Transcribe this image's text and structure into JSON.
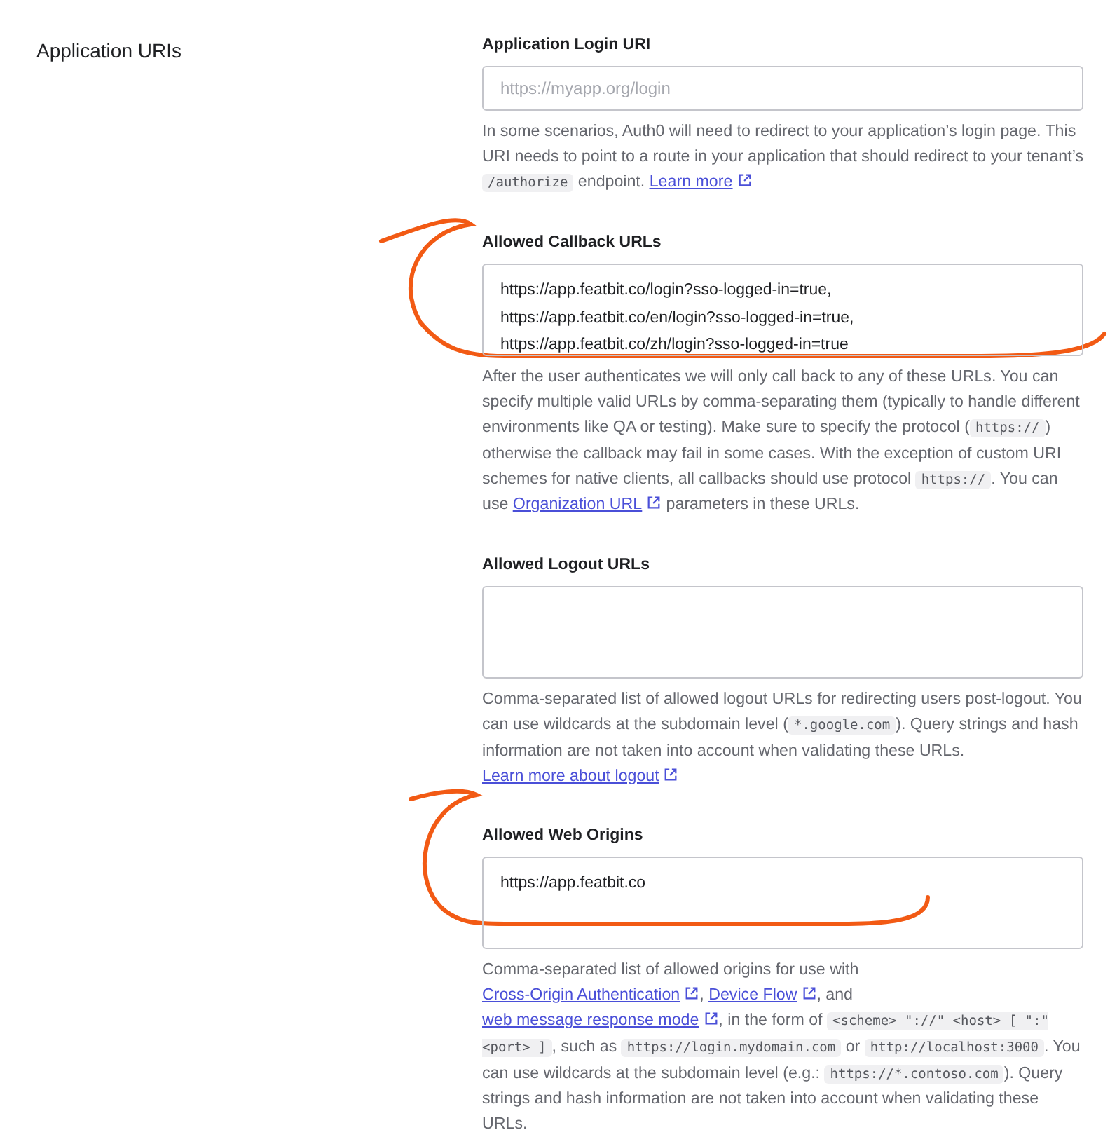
{
  "section": {
    "title": "Application URIs"
  },
  "fields": [
    {
      "label": "Application Login URI",
      "kind": "input",
      "placeholder": "https://myapp.org/login",
      "help": [
        {
          "kind": "text",
          "text": "In some scenarios, Auth0 will need to redirect to your application’s login page. This URI needs to point to a route in your application that should redirect to your tenant’s "
        },
        {
          "kind": "code",
          "text": "/authorize"
        },
        {
          "kind": "text",
          "text": " endpoint. "
        },
        {
          "kind": "link",
          "text": "Learn more"
        }
      ]
    },
    {
      "label": "Allowed Callback URLs",
      "kind": "textarea",
      "value": "https://app.featbit.co/login?sso-logged-in=true,\nhttps://app.featbit.co/en/login?sso-logged-in=true,\nhttps://app.featbit.co/zh/login?sso-logged-in=true",
      "help": [
        {
          "kind": "text",
          "text": "After the user authenticates we will only call back to any of these URLs. You can specify multiple valid URLs by comma-separating them (typically to handle different environments like QA or testing). Make sure to specify the protocol ("
        },
        {
          "kind": "code",
          "text": "https://"
        },
        {
          "kind": "text",
          "text": ") otherwise the callback may fail in some cases. With the exception of custom URI schemes for native clients, all callbacks should use protocol "
        },
        {
          "kind": "code",
          "text": "https://"
        },
        {
          "kind": "text",
          "text": ". You can use "
        },
        {
          "kind": "link",
          "text": "Organization URL"
        },
        {
          "kind": "text",
          "text": " parameters in these URLs."
        }
      ]
    },
    {
      "label": "Allowed Logout URLs",
      "kind": "textarea",
      "help": [
        {
          "kind": "text",
          "text": "Comma-separated list of allowed logout URLs for redirecting users post-logout. You can use wildcards at the subdomain level ("
        },
        {
          "kind": "code",
          "text": "*.google.com"
        },
        {
          "kind": "text",
          "text": "). Query strings and hash information are not taken into account when validating these URLs. "
        },
        {
          "kind": "link",
          "text": "Learn more about logout"
        }
      ]
    },
    {
      "label": "Allowed Web Origins",
      "kind": "textarea",
      "value": "https://app.featbit.co",
      "help": [
        {
          "kind": "text",
          "text": "Comma-separated list of allowed origins for use with "
        },
        {
          "kind": "link",
          "text": "Cross-Origin Authentication"
        },
        {
          "kind": "text",
          "text": ", "
        },
        {
          "kind": "link",
          "text": "Device Flow"
        },
        {
          "kind": "text",
          "text": ", and "
        },
        {
          "kind": "link",
          "text": "web message response mode"
        },
        {
          "kind": "text",
          "text": ", in the form of "
        },
        {
          "kind": "code",
          "text": "<scheme> \"://\" <host> [ \":\" <port> ]"
        },
        {
          "kind": "text",
          "text": ", such as "
        },
        {
          "kind": "code",
          "text": "https://login.mydomain.com"
        },
        {
          "kind": "text",
          "text": " or "
        },
        {
          "kind": "code",
          "text": "http://localhost:3000"
        },
        {
          "kind": "text",
          "text": ". You can use wildcards at the subdomain level (e.g.: "
        },
        {
          "kind": "code",
          "text": "https://*.contoso.com"
        },
        {
          "kind": "text",
          "text": "). Query strings and hash information are not taken into account when validating these URLs."
        }
      ]
    }
  ]
}
